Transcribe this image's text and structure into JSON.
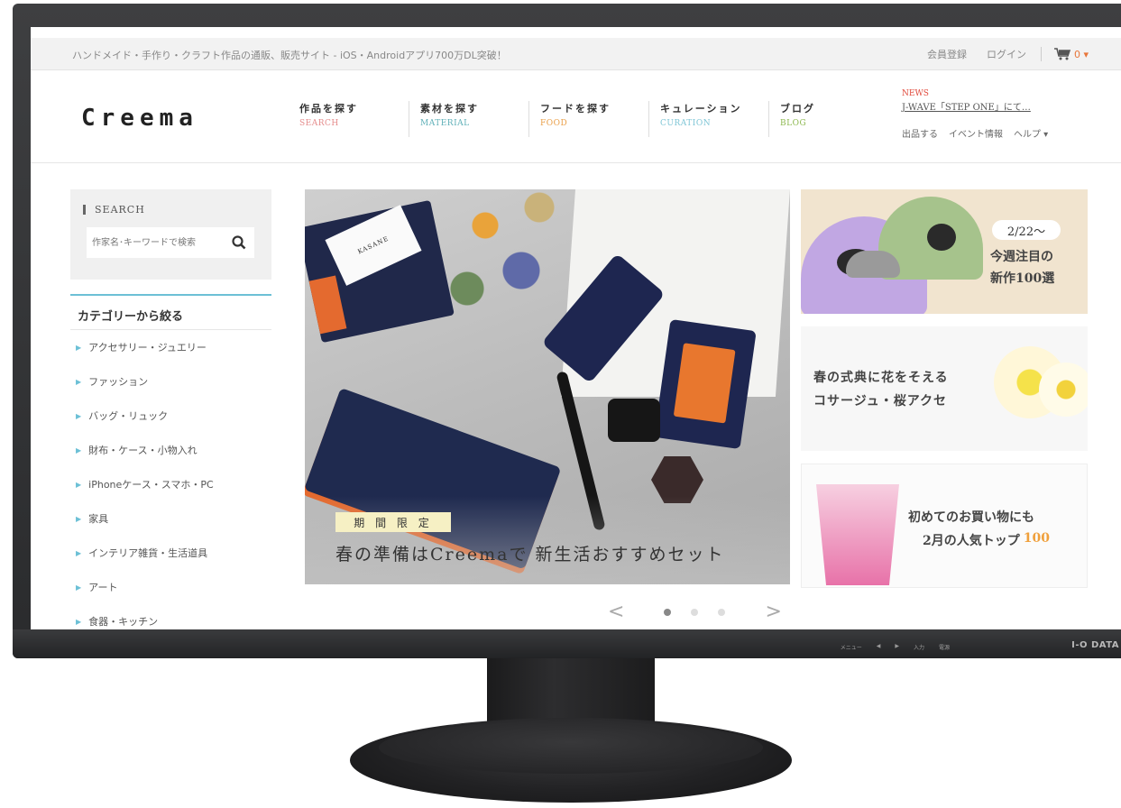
{
  "topbar": {
    "tagline": "ハンドメイド・手作り・クラフト作品の通販、販売サイト - iOS・Androidアプリ700万DL突破！",
    "register": "会員登録",
    "login": "ログイン",
    "cart_count": "0 ▾"
  },
  "header": {
    "logo": "Creema",
    "nav": [
      {
        "jp": "作品を探す",
        "en": "SEARCH",
        "color": "#e58c8c"
      },
      {
        "jp": "素材を探す",
        "en": "MATERIAL",
        "color": "#5fb0b8"
      },
      {
        "jp": "フードを探す",
        "en": "FOOD",
        "color": "#eaa04a"
      },
      {
        "jp": "キュレーション",
        "en": "CURATION",
        "color": "#7fc6d6"
      },
      {
        "jp": "ブログ",
        "en": "BLOG",
        "color": "#8db84f"
      }
    ],
    "news_label": "NEWS",
    "news_text": "J-WAVE「STEP ONE」にて…",
    "subnav": [
      "出品する",
      "イベント情報",
      "ヘルプ ▾"
    ]
  },
  "sidebar": {
    "search_title": "SEARCH",
    "search_placeholder": "作家名･キーワードで検索",
    "category_title": "カテゴリーから絞る",
    "categories": [
      "アクセサリー・ジュエリー",
      "ファッション",
      "バッグ・リュック",
      "財布・ケース・小物入れ",
      "iPhoneケース・スマホ・PC",
      "家具",
      "インテリア雑貨・生活道具",
      "アート",
      "食器・キッチン"
    ]
  },
  "hero": {
    "card_text": "KASANE",
    "badge": "期 間 限 定",
    "title": "春の準備はCreemaで 新生活おすすめセット",
    "prev": "<",
    "next": ">"
  },
  "banners": {
    "b1_date": "2/22〜",
    "b1_line1": "今週注目の",
    "b1_line2": "新作100選",
    "b2_line1": "春の式典に花をそえる",
    "b2_line2": "コサージュ・桜アクセ",
    "b3_line1": "初めてのお買い物にも",
    "b3_line2": "2月の人気トップ",
    "b3_accent": "100"
  },
  "monitor": {
    "brand": "I-O DATA",
    "controls": [
      "メニュー",
      "◀",
      "▶",
      "入力",
      "電源"
    ]
  }
}
